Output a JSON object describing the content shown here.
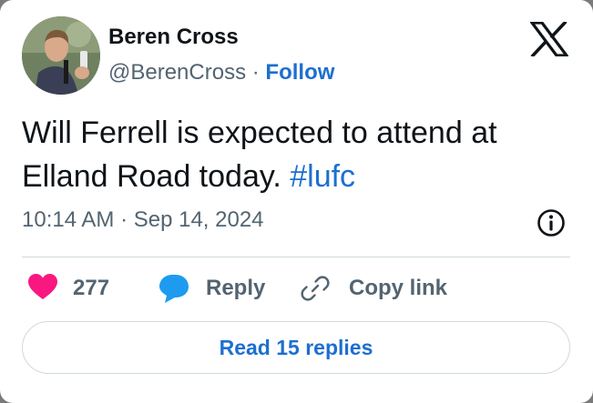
{
  "author": {
    "display_name": "Beren Cross",
    "handle": "@BerenCross",
    "separator": " · ",
    "follow_label": "Follow"
  },
  "tweet": {
    "text": "Will Ferrell is expected to attend at Elland Road today. ",
    "hashtag": "#lufc",
    "timestamp": "10:14 AM · Sep 14, 2024"
  },
  "actions": {
    "like_count": "277",
    "reply_label": "Reply",
    "copy_link_label": "Copy link"
  },
  "footer": {
    "read_replies_label": "Read 15 replies"
  },
  "icons": {
    "logo": "x-logo-icon",
    "info": "info-icon",
    "like": "heart-icon",
    "reply": "speech-bubble-icon",
    "copy": "link-icon"
  },
  "colors": {
    "link_blue": "#1d6fd0",
    "heart_pink": "#f91880",
    "text_primary": "#0f1419",
    "text_secondary": "#536471"
  }
}
